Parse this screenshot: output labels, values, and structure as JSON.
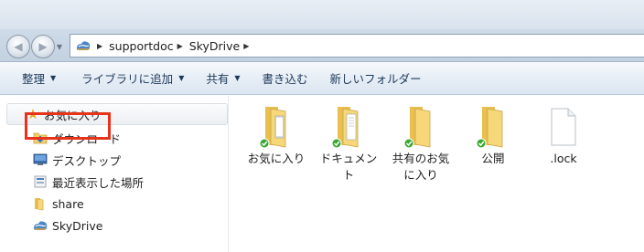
{
  "window": {
    "address_segments": [
      "supportdoc",
      "SkyDrive"
    ]
  },
  "toolbar": {
    "items": [
      {
        "label": "整理",
        "has_dropdown": true
      },
      {
        "label": "ライブラリに追加",
        "has_dropdown": true
      },
      {
        "label": "共有",
        "has_dropdown": true
      },
      {
        "label": "書き込む",
        "has_dropdown": false
      },
      {
        "label": "新しいフォルダー",
        "has_dropdown": false
      }
    ]
  },
  "nav_pane": {
    "favorites_label": "お気に入り",
    "items": [
      {
        "label": "ダウンロード",
        "icon": "download-folder-icon"
      },
      {
        "label": "デスクトップ",
        "icon": "desktop-icon"
      },
      {
        "label": "最近表示した場所",
        "icon": "recent-places-icon"
      },
      {
        "label": "share",
        "icon": "folder-icon"
      },
      {
        "label": "SkyDrive",
        "icon": "skydrive-icon",
        "highlighted": true
      }
    ]
  },
  "content": {
    "items": [
      {
        "label": "お気に入り",
        "type": "folder",
        "synced": true
      },
      {
        "label": "ドキュメント",
        "type": "folder",
        "synced": true
      },
      {
        "label": "共有のお気に入り",
        "type": "folder",
        "synced": true
      },
      {
        "label": "公開",
        "type": "folder",
        "synced": true
      },
      {
        "label": ".lock",
        "type": "file",
        "synced": false
      }
    ]
  },
  "colors": {
    "highlight": "#e8321a",
    "folder": "#f3d478",
    "sync_check": "#3aa832"
  }
}
